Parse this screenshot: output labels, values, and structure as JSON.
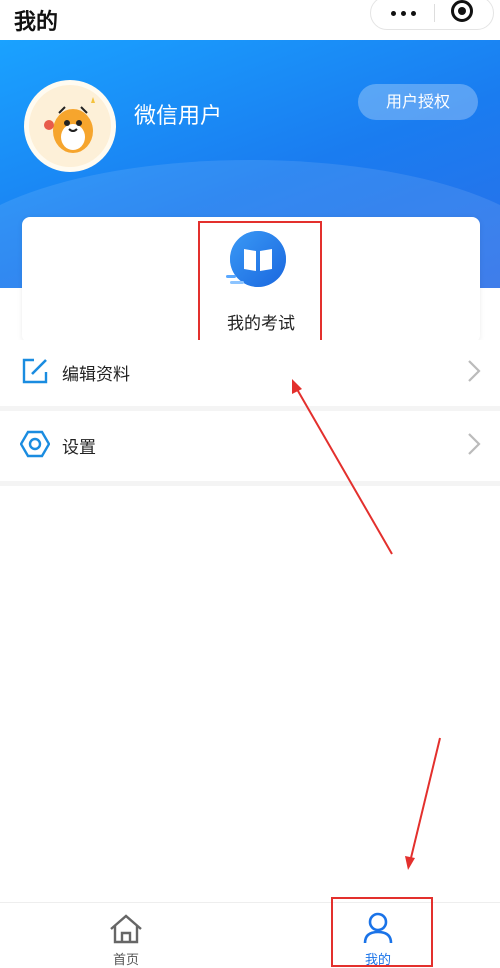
{
  "topbar": {
    "title": "我的"
  },
  "header": {
    "username": "微信用户",
    "auth_button": "用户授权"
  },
  "card": {
    "exam_label": "我的考试"
  },
  "menu": [
    {
      "label": "编辑资料",
      "icon": "edit-icon"
    },
    {
      "label": "设置",
      "icon": "settings-icon"
    }
  ],
  "tabbar": {
    "items": [
      {
        "label": "首页",
        "icon": "home-icon"
      },
      {
        "label": "我的",
        "icon": "user-icon",
        "active": true
      }
    ],
    "active_color": "#1a73e8",
    "inactive_color": "#555555"
  },
  "colors": {
    "accent": "#1a7cf0",
    "highlight": "#e3302d"
  }
}
